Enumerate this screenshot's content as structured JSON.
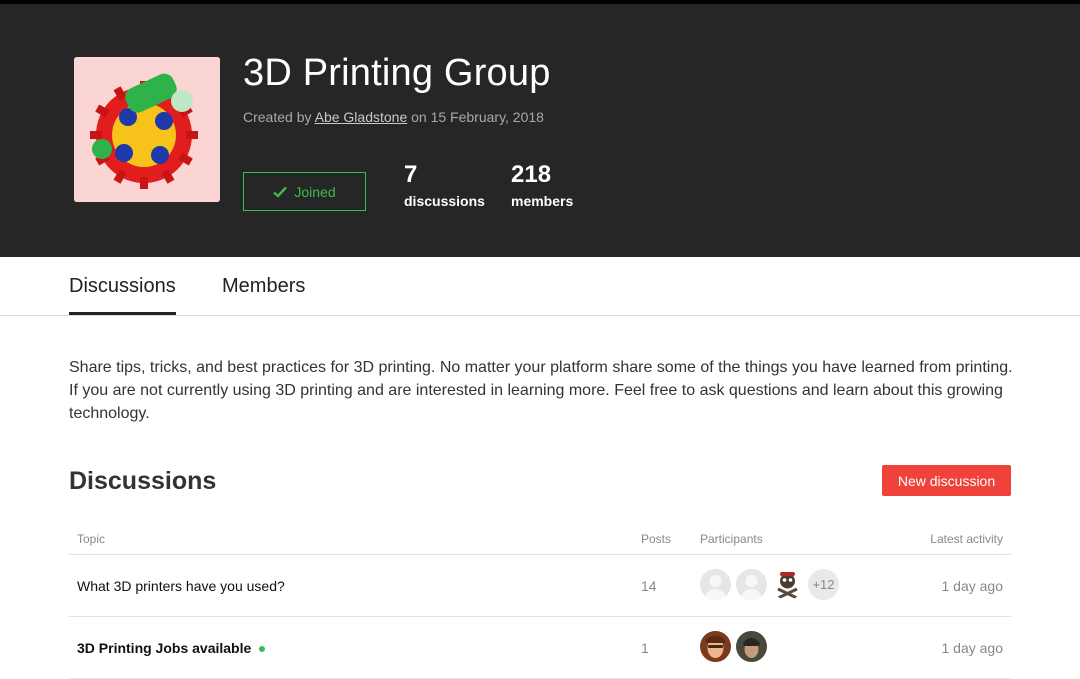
{
  "group": {
    "title": "3D Printing Group",
    "created_prefix": "Created by",
    "creator": "Abe Gladstone",
    "created_suffix": "on 15 February, 2018",
    "joined_label": "Joined",
    "stats": {
      "discussions_count": "7",
      "discussions_label": "discussions",
      "members_count": "218",
      "members_label": "members"
    }
  },
  "tabs": [
    {
      "label": "Discussions",
      "active": true
    },
    {
      "label": "Members",
      "active": false
    }
  ],
  "description": "Share tips, tricks, and best practices for 3D printing. No matter your platform share some of the things you have learned from printing. If you are not currently using 3D printing and are interested in learning more. Feel free to ask questions and learn about this growing technology.",
  "discussions": {
    "title": "Discussions",
    "new_button": "New discussion",
    "columns": {
      "topic": "Topic",
      "posts": "Posts",
      "participants": "Participants",
      "latest": "Latest activity"
    },
    "rows": [
      {
        "topic": "What 3D printers have you used?",
        "posts": "14",
        "more": "+12",
        "latest": "1 day ago"
      },
      {
        "topic": "3D Printing Jobs available",
        "posts": "1",
        "latest": "1 day ago"
      }
    ]
  },
  "colors": {
    "header_bg": "#262626",
    "accent_green": "#3dbb53",
    "accent_red": "#f0423a"
  }
}
